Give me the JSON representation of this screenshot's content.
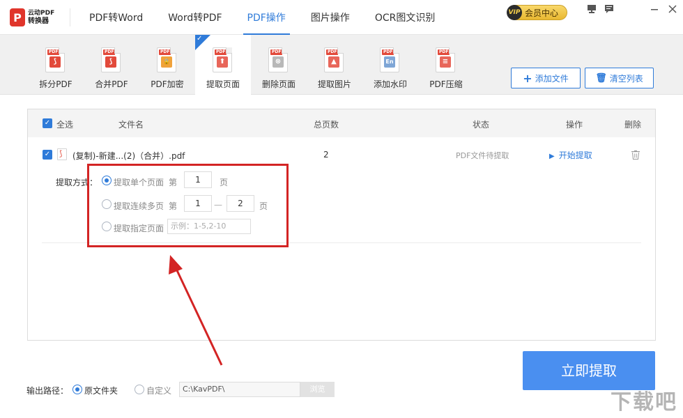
{
  "app": {
    "logo_line1": "云动PDF",
    "logo_line2": "转换器"
  },
  "nav": {
    "tabs": [
      {
        "label": "PDF转Word"
      },
      {
        "label": "Word转PDF"
      },
      {
        "label": "PDF操作",
        "active": true
      },
      {
        "label": "图片操作"
      },
      {
        "label": "OCR图文识别"
      }
    ],
    "vip_badge": "VIP",
    "vip_label": "会员中心"
  },
  "toolbar": {
    "tools": [
      {
        "label": "拆分PDF",
        "icon": "split-pdf-icon",
        "color": "#e24a3b",
        "glyph": "⟆"
      },
      {
        "label": "合并PDF",
        "icon": "merge-pdf-icon",
        "color": "#e24a3b",
        "glyph": "⟆"
      },
      {
        "label": "PDF加密",
        "icon": "encrypt-pdf-icon",
        "color": "#f0a23b",
        "glyph": "🔒"
      },
      {
        "label": "提取页面",
        "icon": "extract-page-icon",
        "color": "#e8665a",
        "glyph": "⬆",
        "active": true
      },
      {
        "label": "删除页面",
        "icon": "delete-page-icon",
        "color": "#b8b8b8",
        "glyph": "⊗"
      },
      {
        "label": "提取图片",
        "icon": "extract-image-icon",
        "color": "#e8665a",
        "glyph": "▲"
      },
      {
        "label": "添加水印",
        "icon": "watermark-icon",
        "color": "#7fa6d6",
        "glyph": "En"
      },
      {
        "label": "PDF压缩",
        "icon": "compress-pdf-icon",
        "color": "#e8665a",
        "glyph": "≡"
      }
    ],
    "add_file_label": "添加文件",
    "clear_list_label": "清空列表"
  },
  "list": {
    "headers": {
      "select_all": "全选",
      "filename": "文件名",
      "pages": "总页数",
      "status": "状态",
      "action": "操作",
      "delete": "删除"
    },
    "rows": [
      {
        "filename": "(复制)-新建...(2)（合并）.pdf",
        "pages": "2",
        "status": "PDF文件待提取",
        "action": "开始提取"
      }
    ],
    "extract": {
      "mode_label": "提取方式：",
      "single_label": "提取单个页面",
      "single_prefix": "第",
      "single_value": "1",
      "single_suffix": "页",
      "range_label": "提取连续多页",
      "range_prefix": "第",
      "range_from": "1",
      "range_dash": "—",
      "range_to": "2",
      "range_suffix": "页",
      "custom_label": "提取指定页面",
      "custom_placeholder": "示例：1-5,2-10"
    }
  },
  "output": {
    "label": "输出路径：",
    "original_folder": "原文件夹",
    "custom": "自定义",
    "path": "C:\\KavPDF\\",
    "browse": "浏览"
  },
  "primary_button": "立即提取",
  "watermark": "下载吧"
}
